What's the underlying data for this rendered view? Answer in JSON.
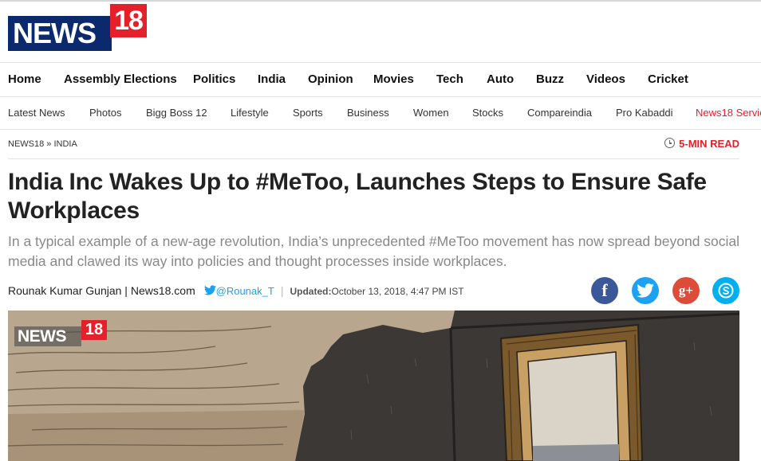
{
  "brand": {
    "logo_word": "NEWS",
    "logo_number": "18"
  },
  "primary_nav": [
    "Home",
    "Assembly Elections",
    "Politics",
    "India",
    "Opinion",
    "Movies",
    "Tech",
    "Auto",
    "Buzz",
    "Videos",
    "Cricket"
  ],
  "secondary_nav": [
    "Latest News",
    "Photos",
    "Bigg Boss 12",
    "Lifestyle",
    "Sports",
    "Business",
    "Women",
    "Stocks",
    "Compareindia",
    "Pro Kabaddi",
    "News18 Servic"
  ],
  "breadcrumb": "NEWS18 » INDIA",
  "read_time": "5-MIN READ",
  "article": {
    "headline": "India Inc Wakes Up to #MeToo, Launches Steps to Ensure Safe Workplaces",
    "subheadline": "In a typical example of a new-age revolution, India’s unprecedented #MeToo movement has now spread beyond social media and clawed its way into policies and thought processes inside workplaces.",
    "author": "Rounak Kumar Gunjan | News18.com",
    "twitter_handle": "@Rounak_T",
    "updated_label": "Updated:",
    "updated_value": "October 13, 2018, 4:47 PM IST"
  },
  "share": {
    "facebook": "f",
    "google_plus": "g+"
  },
  "hero_watermark": {
    "word": "NEWS",
    "number": "18"
  },
  "colors": {
    "brand_blue": "#0b2a6e",
    "brand_red": "#e5202a",
    "twitter": "#1da1f2",
    "facebook": "#3b5998",
    "google": "#dd4b39",
    "skype": "#00aff0"
  },
  "icons": [
    "clock-icon",
    "twitter-bird-icon",
    "facebook-icon",
    "twitter-icon",
    "google-plus-icon",
    "skype-icon"
  ]
}
